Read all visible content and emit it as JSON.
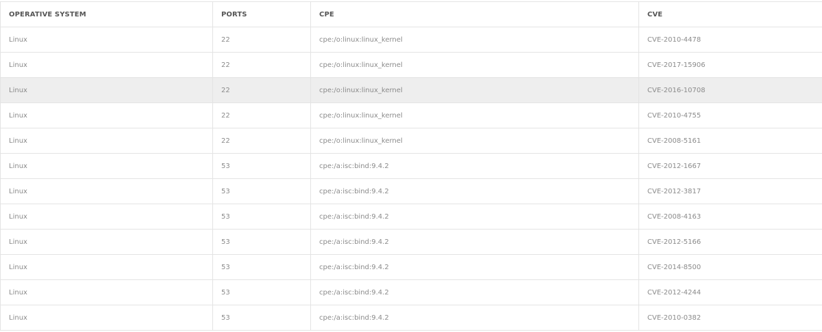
{
  "table": {
    "headers": [
      "OPERATIVE SYSTEM",
      "PORTS",
      "CPE",
      "CVE"
    ],
    "highlighted_row": 2,
    "rows": [
      [
        "Linux",
        "22",
        "cpe:/o:linux:linux_kernel",
        "CVE-2010-4478"
      ],
      [
        "Linux",
        "22",
        "cpe:/o:linux:linux_kernel",
        "CVE-2017-15906"
      ],
      [
        "Linux",
        "22",
        "cpe:/o:linux:linux_kernel",
        "CVE-2016-10708"
      ],
      [
        "Linux",
        "22",
        "cpe:/o:linux:linux_kernel",
        "CVE-2010-4755"
      ],
      [
        "Linux",
        "22",
        "cpe:/o:linux:linux_kernel",
        "CVE-2008-5161"
      ],
      [
        "Linux",
        "53",
        "cpe:/a:isc:bind:9.4.2",
        "CVE-2012-1667"
      ],
      [
        "Linux",
        "53",
        "cpe:/a:isc:bind:9.4.2",
        "CVE-2012-3817"
      ],
      [
        "Linux",
        "53",
        "cpe:/a:isc:bind:9.4.2",
        "CVE-2008-4163"
      ],
      [
        "Linux",
        "53",
        "cpe:/a:isc:bind:9.4.2",
        "CVE-2012-5166"
      ],
      [
        "Linux",
        "53",
        "cpe:/a:isc:bind:9.4.2",
        "CVE-2014-8500"
      ],
      [
        "Linux",
        "53",
        "cpe:/a:isc:bind:9.4.2",
        "CVE-2012-4244"
      ],
      [
        "Linux",
        "53",
        "cpe:/a:isc:bind:9.4.2",
        "CVE-2010-0382"
      ]
    ]
  },
  "colors": {
    "header_text": "#555555",
    "cell_text": "#8a8a8a",
    "border": "#e3e3e3",
    "highlight_bg": "#eeeeee"
  }
}
